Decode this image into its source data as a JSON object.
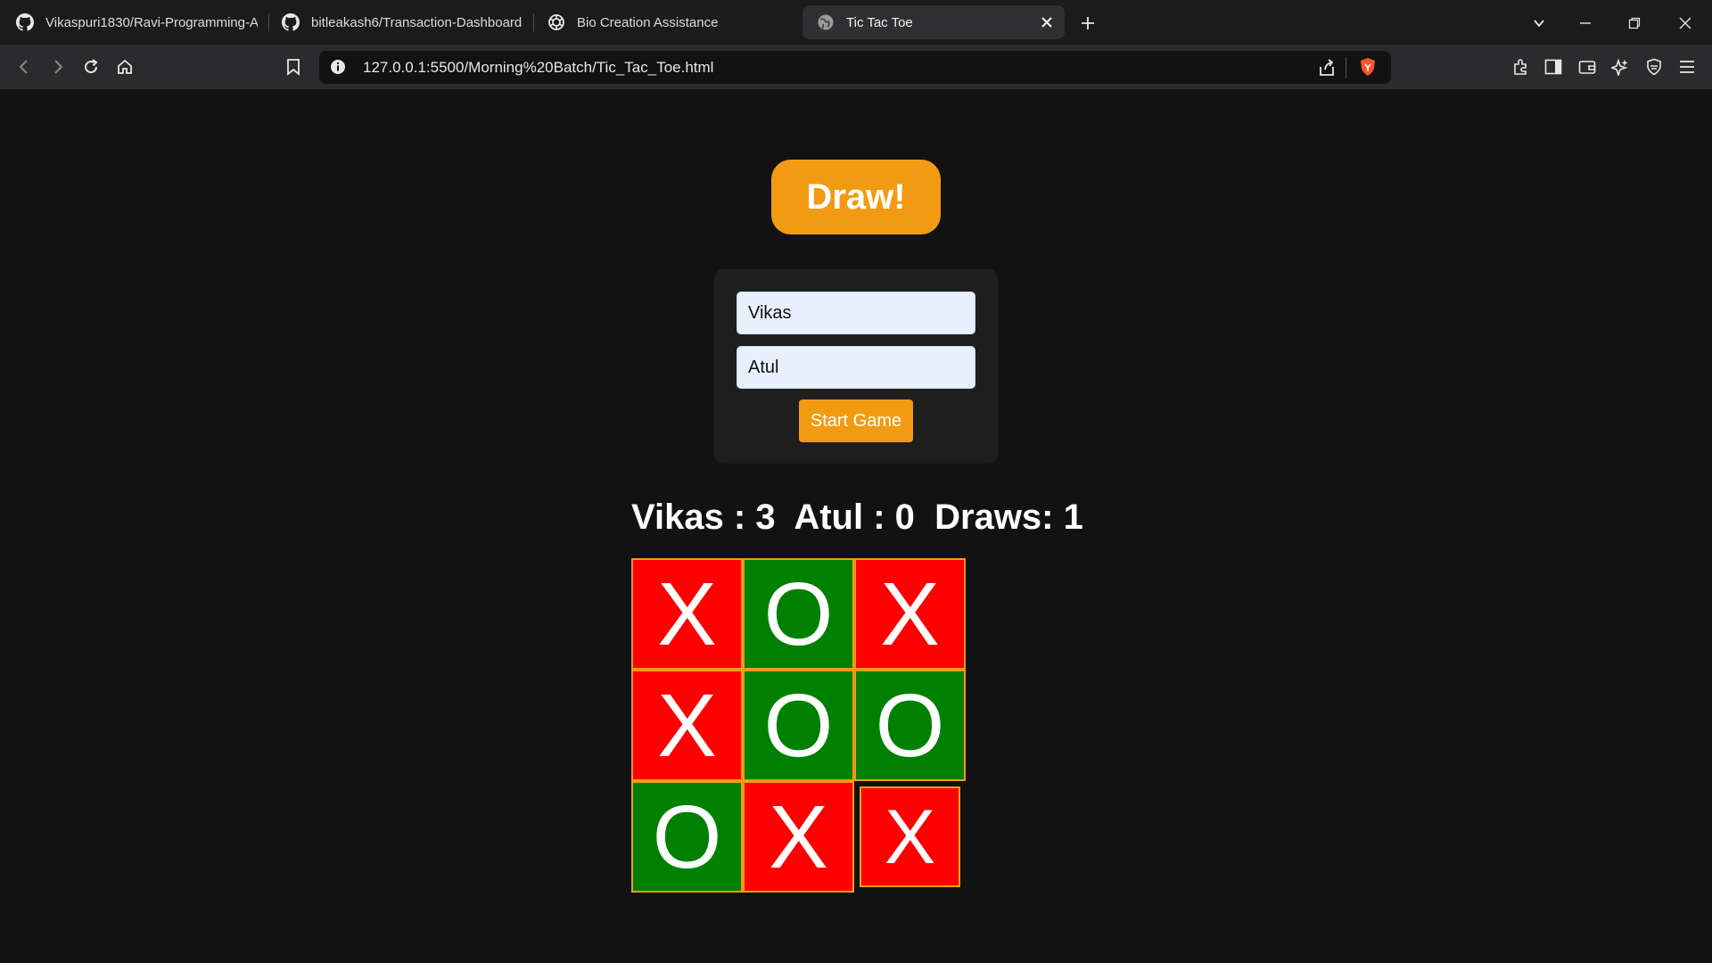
{
  "tabs": [
    {
      "title": "Vikaspuri1830/Ravi-Programming-A",
      "icon": "github-icon"
    },
    {
      "title": "bitleakash6/Transaction-Dashboard",
      "icon": "github-icon"
    },
    {
      "title": "Bio Creation Assistance",
      "icon": "openai-icon"
    },
    {
      "title": "Tic Tac Toe",
      "icon": "globe-icon",
      "active": true
    }
  ],
  "address_bar": {
    "url": "127.0.0.1:5500/Morning%20Batch/Tic_Tac_Toe.html"
  },
  "game": {
    "status": "Draw!",
    "player1_value": "Vikas",
    "player2_value": "Atul",
    "start_label": "Start Game",
    "score_text": "Vikas : 3  Atul : 0  Draws: 1",
    "board": [
      "X",
      "O",
      "X",
      "X",
      "O",
      "O",
      "O",
      "X",
      "X"
    ]
  },
  "colors": {
    "accent": "#f29b12",
    "x_cell": "#ff0000",
    "o_cell": "#008000",
    "page_bg": "#121212"
  }
}
